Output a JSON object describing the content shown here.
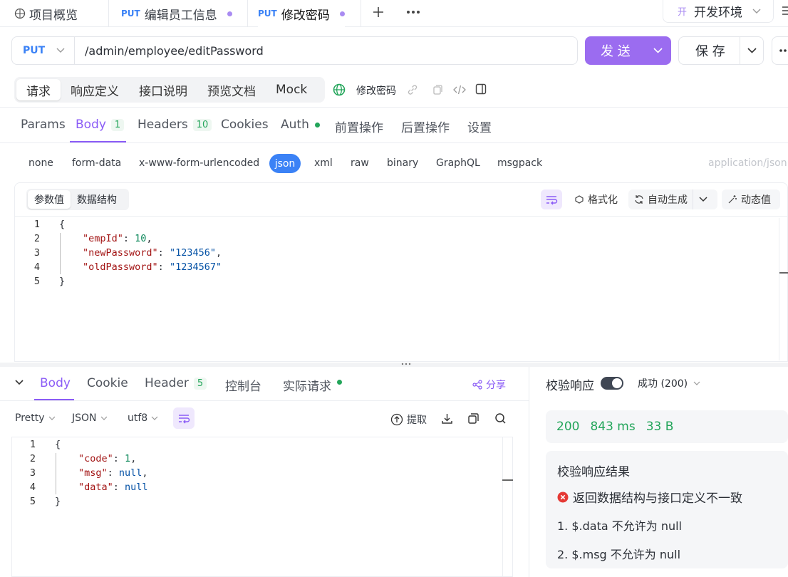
{
  "tabs": {
    "overview": "项目概览",
    "tab1": {
      "method": "PUT",
      "label": "编辑员工信息"
    },
    "tab2": {
      "method": "PUT",
      "label": "修改密码"
    },
    "env_badge": "开",
    "env": "开发环境"
  },
  "request": {
    "method": "PUT",
    "url": "/admin/employee/editPassword",
    "send": "发 送",
    "save": "保 存"
  },
  "sections": [
    "请求",
    "响应定义",
    "接口说明",
    "预览文档",
    "Mock"
  ],
  "api_name": "修改密码",
  "params_tabs": {
    "params": "Params",
    "body": "Body",
    "body_count": "1",
    "headers": "Headers",
    "headers_count": "10",
    "cookies": "Cookies",
    "auth": "Auth",
    "pre": "前置操作",
    "post": "后置操作",
    "settings": "设置"
  },
  "body_types": [
    "none",
    "form-data",
    "x-www-form-urlencoded",
    "json",
    "xml",
    "raw",
    "binary",
    "GraphQL",
    "msgpack"
  ],
  "content_type": "application/json",
  "editor_modes": {
    "values": "参数值",
    "schema": "数据结构"
  },
  "editor_tools": {
    "format": "格式化",
    "auto": "自动生成",
    "dynamic": "动态值"
  },
  "request_code": {
    "line1": "{",
    "k1": "\"empId\"",
    "v1": "10",
    "k2": "\"newPassword\"",
    "v2": "\"123456\"",
    "k3": "\"oldPassword\"",
    "v3": "\"1234567\"",
    "line5": "}"
  },
  "response_tabs": {
    "body": "Body",
    "cookie": "Cookie",
    "header": "Header",
    "header_count": "5",
    "console": "控制台",
    "actual": "实际请求",
    "share": "分享"
  },
  "response_opts": {
    "pretty": "Pretty",
    "format": "JSON",
    "encoding": "utf8",
    "extract": "提取"
  },
  "response_code": {
    "line1": "{",
    "k1": "\"code\"",
    "v1": "1",
    "k2": "\"msg\"",
    "v2": "null",
    "k3": "\"data\"",
    "v3": "null",
    "line5": "}"
  },
  "validation": {
    "label": "校验响应",
    "status_select": "成功 (200)",
    "status": "200",
    "time": "843 ms",
    "size": "33 B",
    "result_title": "校验响应结果",
    "error": "返回数据结构与接口定义不一致",
    "item1": "1. $.data 不允许为 null",
    "item2": "2. $.msg 不允许为 null"
  }
}
